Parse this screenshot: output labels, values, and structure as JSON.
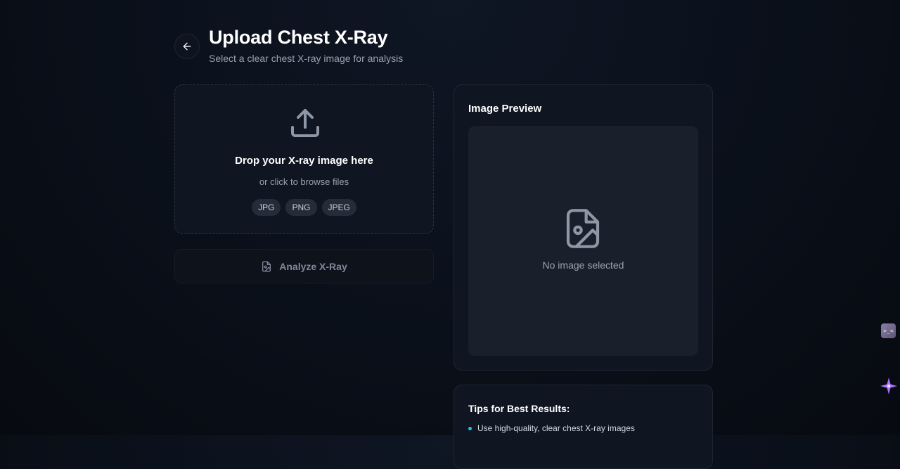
{
  "header": {
    "title": "Upload Chest X-Ray",
    "subtitle": "Select a clear chest X-ray image for analysis",
    "back_icon": "arrow-left-icon"
  },
  "dropzone": {
    "icon": "upload-icon",
    "title": "Drop your X-ray image here",
    "subtitle": "or click to browse files",
    "formats": [
      "JPG",
      "PNG",
      "JPEG"
    ]
  },
  "analyze_button": {
    "label": "Analyze X-Ray",
    "icon": "file-image-icon",
    "enabled": false
  },
  "preview": {
    "title": "Image Preview",
    "empty_text": "No image selected",
    "icon": "file-image-icon"
  },
  "tips": {
    "title": "Tips for Best Results:",
    "items": [
      "Use high-quality, clear chest X-ray images"
    ]
  },
  "side_widget": {
    "label": ">_<"
  },
  "colors": {
    "background": "#0b111c",
    "card": "#0f1521",
    "preview_area": "#1a202b",
    "chip": "#252c39",
    "muted_text": "#9aa3b2",
    "accent": "#22c3e6"
  }
}
